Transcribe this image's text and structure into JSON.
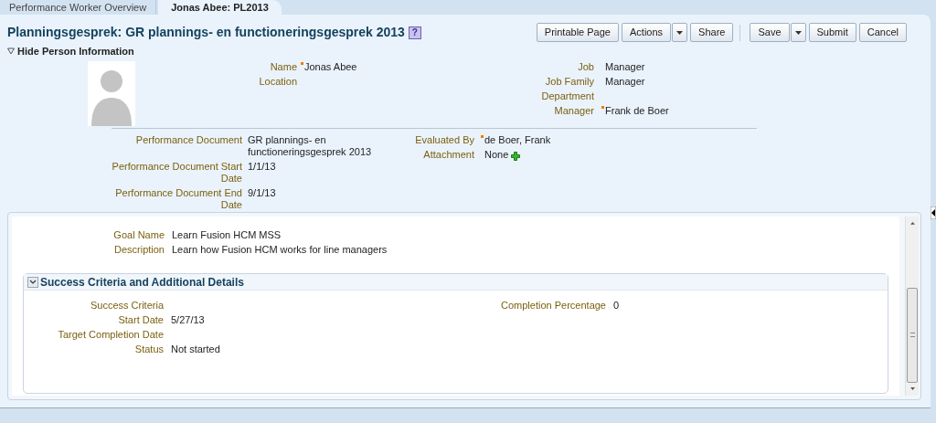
{
  "tabs": [
    {
      "label": "Performance Worker Overview",
      "selected": false
    },
    {
      "label": "Jonas Abee: PL2013",
      "selected": true
    }
  ],
  "page_title": "Planningsgesprek: GR plannings- en functioneringsgesprek 2013",
  "help_icon": "?",
  "toolbar": [
    [
      {
        "label": "Printable Page",
        "kind": "button"
      },
      {
        "label": "Actions",
        "kind": "split"
      },
      {
        "label": "Share",
        "kind": "button"
      }
    ],
    [
      {
        "label": "Save",
        "kind": "split"
      },
      {
        "label": "Submit",
        "kind": "button"
      },
      {
        "label": "Cancel",
        "kind": "button"
      }
    ]
  ],
  "person_section": {
    "label": "Hide Person Information",
    "expanded": true
  },
  "person_fields_left": [
    {
      "label": "Name",
      "value": "Jonas Abee",
      "marked": true
    },
    {
      "label": "Location",
      "marked": false
    }
  ],
  "person_fields_right": [
    {
      "label": "Job",
      "value": "Manager",
      "marked": false
    },
    {
      "label": "Job Family",
      "value": "Manager",
      "marked": false
    },
    {
      "label": "Department",
      "marked": false
    },
    {
      "label": "Manager",
      "value": "Frank de Boer",
      "marked": true
    }
  ],
  "document_fields_left": [
    {
      "label": "Performance Document",
      "value": "GR plannings- en functioneringsgesprek 2013"
    },
    {
      "label": "Performance Document Start Date",
      "value": "1/1/13"
    },
    {
      "label": "Performance Document End Date",
      "value": "9/1/13"
    }
  ],
  "document_fields_right": [
    {
      "label": "Evaluated By",
      "value": "de Boer, Frank",
      "marked": true,
      "kind": "text"
    },
    {
      "label": "Attachment",
      "value": "None",
      "marked": false,
      "kind": "add"
    }
  ],
  "goal_fields": [
    {
      "label": "Goal Name",
      "value": "Learn Fusion HCM MSS"
    },
    {
      "label": "Description",
      "value": "Learn how Fusion HCM works for line managers"
    }
  ],
  "success_section": {
    "title": "Success Criteria and Additional Details",
    "expanded": true
  },
  "success_fields_left": [
    {
      "label": "Success Criteria"
    },
    {
      "label": "Start Date",
      "value": "5/27/13"
    },
    {
      "label": "Target Completion Date"
    },
    {
      "label": "Status",
      "value": "Not started"
    }
  ],
  "success_fields_right": [
    {
      "label": "Completion Percentage",
      "value": "0"
    }
  ]
}
